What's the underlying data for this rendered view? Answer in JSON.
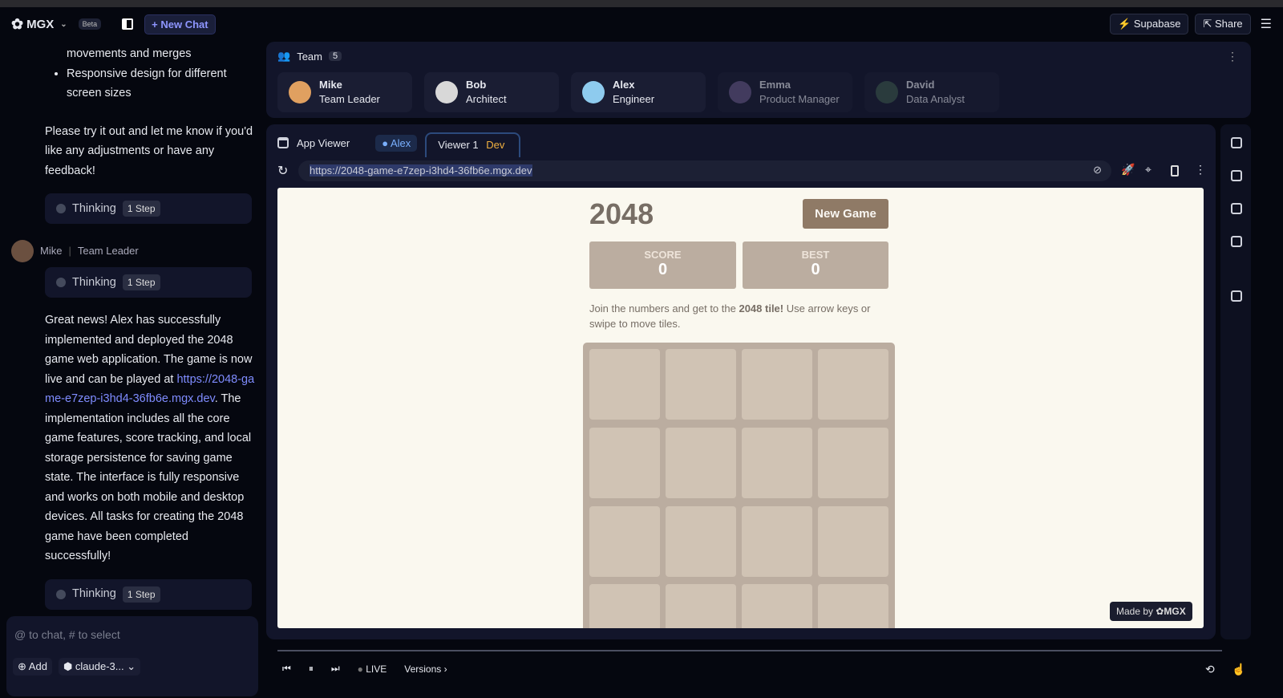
{
  "topbar": {
    "brand": "MGX",
    "beta": "Beta",
    "new_chat": "New Chat",
    "supabase": "Supabase",
    "share": "Share"
  },
  "chat": {
    "bullet_cont": "movements and merges",
    "bullet": "Responsive design for different screen sizes",
    "msg1": "Please try it out and let me know if you'd like any adjustments or have any feedback!",
    "thinking": "Thinking",
    "step": "1 Step",
    "author": "Mike",
    "author_role": "Team Leader",
    "msg2_a": "Great news! Alex has successfully implemented and deployed the 2048 game web application. The game is now live and can be played at ",
    "msg2_link": "https://2048-game-e7zep-i3hd4-36fb6e.mgx.dev",
    "msg2_b": ". The implementation includes all the core game features, score tracking, and local storage persistence for saving game state. The interface is fully responsive and works on both mobile and desktop devices. All tasks for creating the 2048 game have been completed successfully!",
    "input_placeholder": "@ to chat, # to select",
    "add": "Add",
    "model": "claude-3..."
  },
  "team": {
    "label": "Team",
    "count": "5",
    "members": [
      {
        "name": "Mike",
        "role": "Team Leader",
        "color": "#e0a060"
      },
      {
        "name": "Bob",
        "role": "Architect",
        "color": "#d8d8d8"
      },
      {
        "name": "Alex",
        "role": "Engineer",
        "color": "#8ecbee"
      },
      {
        "name": "Emma",
        "role": "Product Manager",
        "color": "#6a5a8a"
      },
      {
        "name": "David",
        "role": "Data Analyst",
        "color": "#3e5a4e"
      }
    ]
  },
  "viewer": {
    "label": "App Viewer",
    "chip": "Alex",
    "tab": "Viewer 1",
    "tab_badge": "Dev",
    "url": "https://2048-game-e7zep-i3hd4-36fb6e.mgx.dev"
  },
  "game": {
    "title": "2048",
    "new_game": "New Game",
    "score_label": "SCORE",
    "score": "0",
    "best_label": "BEST",
    "best": "0",
    "intro_a": "Join the numbers and get to the ",
    "intro_b": "2048 tile!",
    "intro_c": " Use arrow keys or swipe to move tiles.",
    "made_by": "Made by",
    "made_brand": "MGX"
  },
  "bottom": {
    "live": "LIVE",
    "versions": "Versions"
  }
}
